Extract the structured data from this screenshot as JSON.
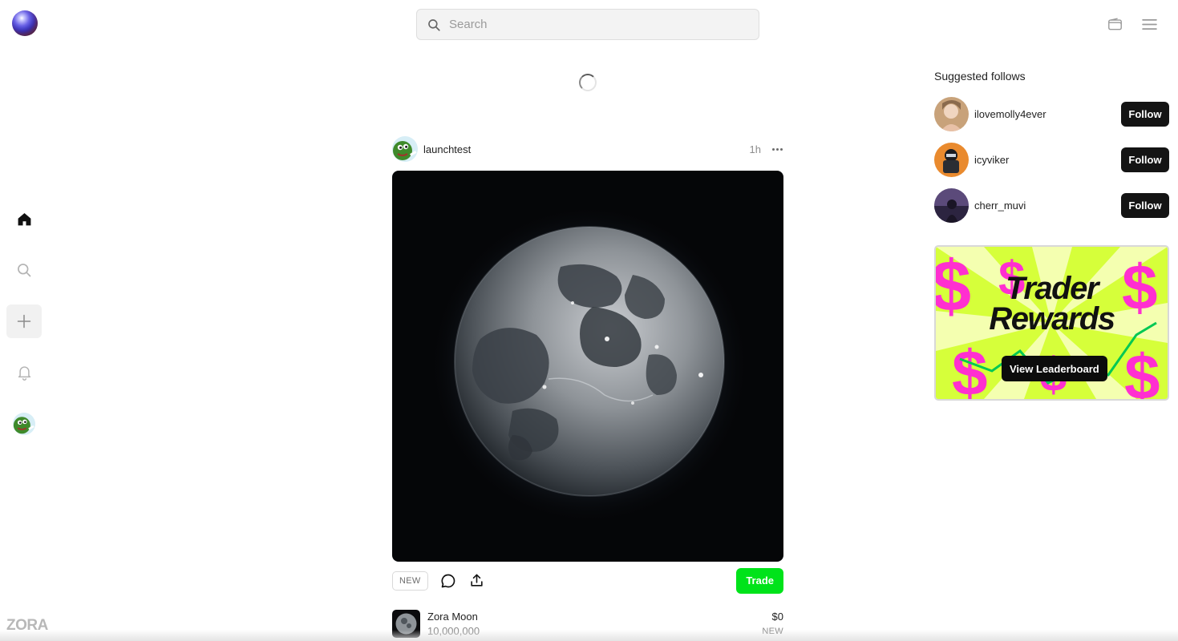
{
  "brand": {
    "logo_icon": "orb-logo-icon",
    "wordmark": "ZORA"
  },
  "search": {
    "placeholder": "Search"
  },
  "top_right": {
    "wallet_icon": "wallet-icon",
    "menu_icon": "hamburger-menu-icon"
  },
  "nav": {
    "items": [
      {
        "name": "home",
        "icon": "home-icon"
      },
      {
        "name": "search",
        "icon": "search-icon"
      },
      {
        "name": "create",
        "icon": "plus-icon"
      },
      {
        "name": "notifications",
        "icon": "bell-icon"
      },
      {
        "name": "profile",
        "icon": "avatar"
      }
    ]
  },
  "feed": {
    "loading": true,
    "post": {
      "username": "launchtest",
      "time": "1h",
      "badge": "NEW",
      "trade_label": "Trade",
      "coin": {
        "name": "Zora Moon",
        "supply": "10,000,000",
        "price": "$0",
        "status": "NEW"
      }
    }
  },
  "sidebar": {
    "title": "Suggested follows",
    "suggestions": [
      {
        "username": "ilovemolly4ever",
        "button": "Follow"
      },
      {
        "username": "icyviker",
        "button": "Follow"
      },
      {
        "username": "cherr_muvi",
        "button": "Follow"
      }
    ],
    "promo": {
      "line1": "Trader",
      "line2": "Rewards",
      "button": "View Leaderboard"
    }
  },
  "colors": {
    "trade_green": "#00e31a",
    "follow_black": "#141414",
    "promo_pink": "#ff2fd0",
    "promo_lime": "#c8ff2e"
  }
}
